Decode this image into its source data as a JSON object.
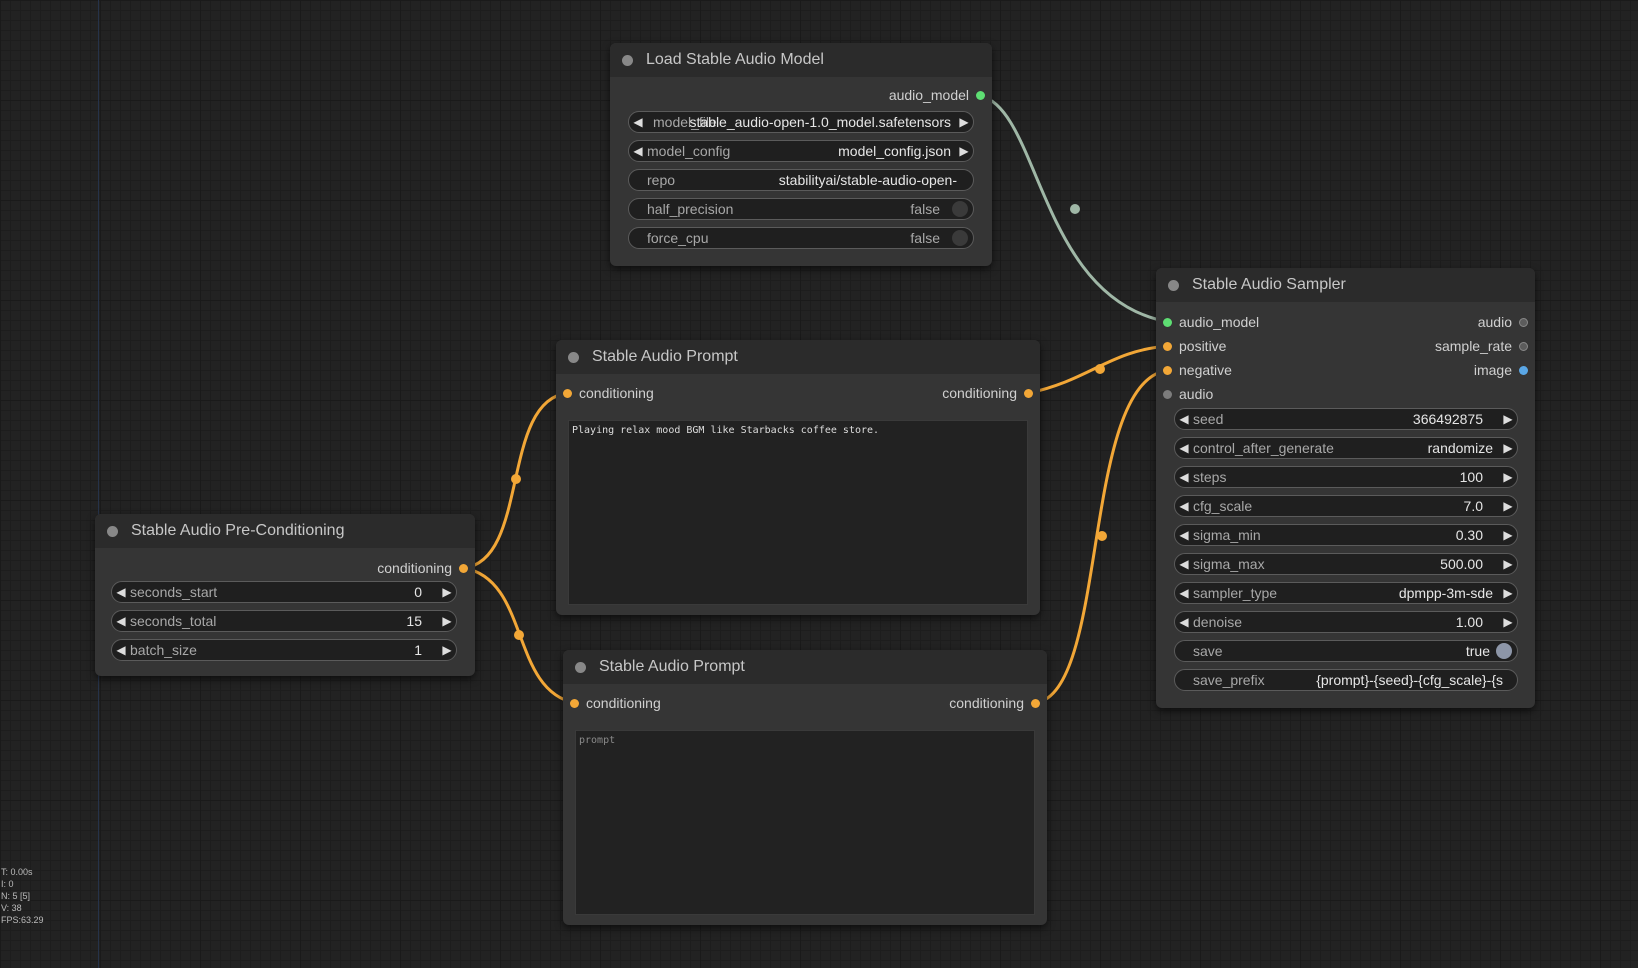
{
  "nodes": {
    "load_model": {
      "title": "Load Stable Audio Model",
      "output": "audio_model",
      "widgets": {
        "model_file": {
          "label": "model_file",
          "value": "stable_audio-open-1.0_model.safetensors"
        },
        "model_config": {
          "label": "model_config",
          "value": "model_config.json"
        },
        "repo": {
          "label": "repo",
          "value": "stabilityai/stable-audio-open-"
        },
        "half_precision": {
          "label": "half_precision",
          "value": "false"
        },
        "force_cpu": {
          "label": "force_cpu",
          "value": "false"
        }
      }
    },
    "preconditioning": {
      "title": "Stable Audio Pre-Conditioning",
      "output": "conditioning",
      "widgets": {
        "seconds_start": {
          "label": "seconds_start",
          "value": "0"
        },
        "seconds_total": {
          "label": "seconds_total",
          "value": "15"
        },
        "batch_size": {
          "label": "batch_size",
          "value": "1"
        }
      }
    },
    "prompt1": {
      "title": "Stable Audio Prompt",
      "input": "conditioning",
      "output": "conditioning",
      "text": "Playing relax mood BGM like Starbacks coffee store."
    },
    "prompt2": {
      "title": "Stable Audio Prompt",
      "input": "conditioning",
      "output": "conditioning",
      "placeholder": "prompt"
    },
    "sampler": {
      "title": "Stable Audio Sampler",
      "inputs": [
        "audio_model",
        "positive",
        "negative",
        "audio"
      ],
      "outputs": [
        "audio",
        "sample_rate",
        "image"
      ],
      "widgets": {
        "seed": {
          "label": "seed",
          "value": "366492875"
        },
        "control_after_generate": {
          "label": "control_after_generate",
          "value": "randomize"
        },
        "steps": {
          "label": "steps",
          "value": "100"
        },
        "cfg_scale": {
          "label": "cfg_scale",
          "value": "7.0"
        },
        "sigma_min": {
          "label": "sigma_min",
          "value": "0.30"
        },
        "sigma_max": {
          "label": "sigma_max",
          "value": "500.00"
        },
        "sampler_type": {
          "label": "sampler_type",
          "value": "dpmpp-3m-sde"
        },
        "denoise": {
          "label": "denoise",
          "value": "1.00"
        },
        "save": {
          "label": "save",
          "value": "true"
        },
        "save_prefix": {
          "label": "save_prefix",
          "value": "{prompt}-{seed}-{cfg_scale}-{s"
        }
      }
    }
  },
  "stats": {
    "t": "T: 0.00s",
    "i": "I: 0",
    "n": "N: 5 [5]",
    "v": "V: 38",
    "fps": "FPS:63.29"
  },
  "colors": {
    "conditioning_link": "#f2a737",
    "model_link": "#9fb7a6",
    "canvas": "#222222",
    "node_body": "#353535",
    "node_title": "#2b2b2b"
  }
}
